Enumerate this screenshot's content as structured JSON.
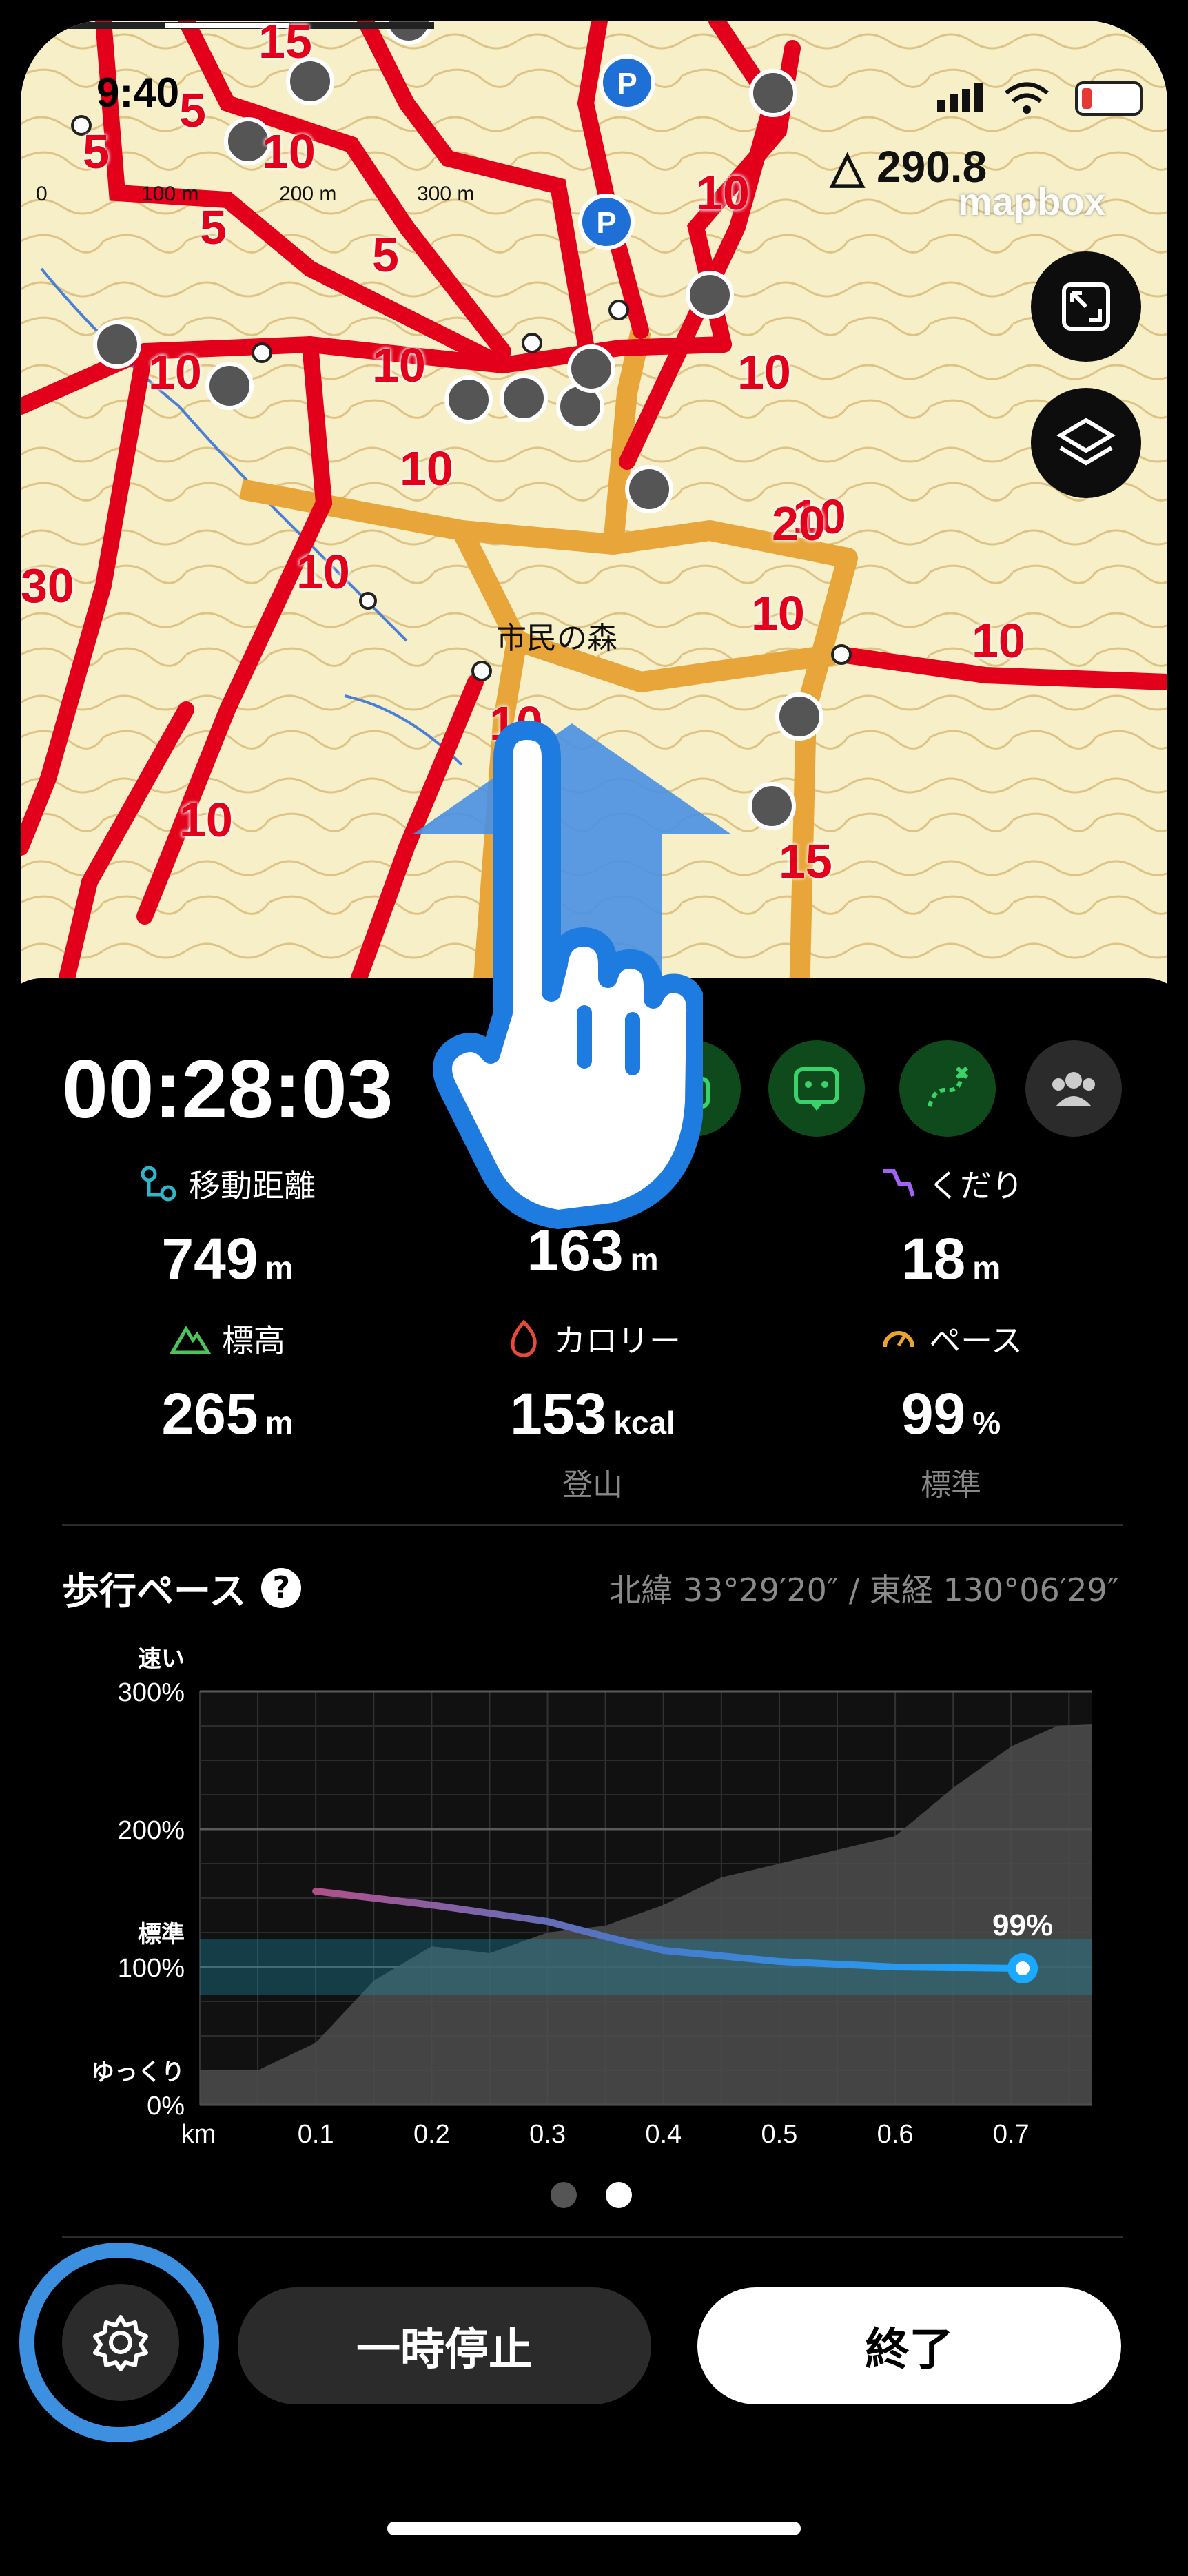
{
  "status_bar": {
    "time": "9:40"
  },
  "map": {
    "scale_labels": [
      "0",
      "100 m",
      "200 m",
      "300 m"
    ],
    "summit_label": "290.8",
    "attribution": "mapbox",
    "place_label": "市民の森",
    "contour_labels": [
      "15",
      "5",
      "5",
      "5",
      "5",
      "10",
      "10",
      "10",
      "10",
      "10",
      "10",
      "10",
      "10",
      "10",
      "10",
      "20",
      "30",
      "10",
      "15",
      "10"
    ]
  },
  "activity": {
    "elapsed": "00:28:03",
    "stats": [
      {
        "label": "移動距離",
        "value": "749",
        "unit": "m",
        "sub": "",
        "icon": "route-icon",
        "color": "#2fb6c9"
      },
      {
        "label": "",
        "value": "163",
        "unit": "m",
        "sub": "",
        "icon": "ascent-icon",
        "color": "#3cc46a"
      },
      {
        "label": "くだり",
        "value": "18",
        "unit": "m",
        "sub": "",
        "icon": "descent-icon",
        "color": "#a462f5"
      },
      {
        "label": "標高",
        "value": "265",
        "unit": "m",
        "sub": "",
        "icon": "mountain-icon",
        "color": "#4cc45a"
      },
      {
        "label": "カロリー",
        "value": "153",
        "unit": "kcal",
        "sub": "登山",
        "icon": "flame-icon",
        "color": "#e64a3a"
      },
      {
        "label": "ペース",
        "value": "99",
        "unit": "%",
        "sub": "標準",
        "icon": "speedometer-icon",
        "color": "#e9a52a"
      }
    ]
  },
  "pace": {
    "title": "歩行ペース",
    "help": "?",
    "coordinates": "北緯 33°29′20″ / 東経 130°06′29″"
  },
  "chart_data": {
    "type": "line",
    "title": "歩行ペース",
    "xlabel": "km",
    "ylabel": "",
    "x_ticks": [
      "0.1",
      "0.2",
      "0.3",
      "0.4",
      "0.5",
      "0.6",
      "0.7"
    ],
    "y_ticks": [
      "0%",
      "100%",
      "200%",
      "300%"
    ],
    "y_tick_words": {
      "top": "速い",
      "mid": "標準",
      "bottom": "ゆっくり"
    },
    "xlim": [
      0,
      0.77
    ],
    "ylim": [
      0,
      300
    ],
    "standard_band": [
      80,
      120
    ],
    "series": [
      {
        "x": [
          0.1,
          0.2,
          0.3,
          0.35,
          0.4,
          0.5,
          0.6,
          0.71
        ],
        "values": [
          155,
          145,
          133,
          122,
          112,
          104,
          100,
          99
        ]
      }
    ],
    "elevation_profile": {
      "x": [
        0,
        0.05,
        0.1,
        0.15,
        0.2,
        0.25,
        0.3,
        0.35,
        0.4,
        0.45,
        0.5,
        0.55,
        0.6,
        0.65,
        0.7,
        0.74,
        0.77
      ],
      "values": [
        25,
        25,
        45,
        90,
        115,
        110,
        125,
        130,
        145,
        165,
        175,
        185,
        195,
        230,
        260,
        275,
        276
      ]
    },
    "current_label": "99%"
  },
  "buttons": {
    "pause": "一時停止",
    "finish": "終了"
  },
  "colors": {
    "accent": "#1ba8ff",
    "annotation": "#3d8fe0",
    "trail": "#e3001b",
    "route": "#e8a63a"
  }
}
